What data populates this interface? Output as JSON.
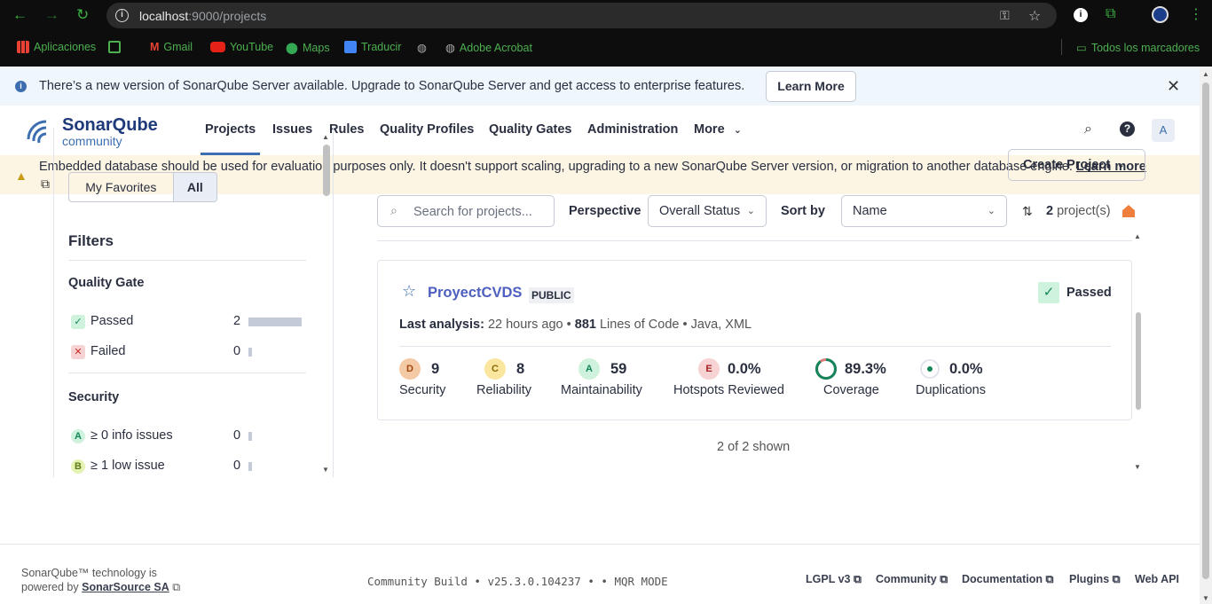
{
  "browser": {
    "url_host": "localhost",
    "url_rest": ":9000/projects",
    "bookmarks": [
      "Aplicaciones",
      "Gmail",
      "YouTube",
      "Maps",
      "Traducir",
      "Adobe Acrobat",
      "Todos los marcadores"
    ]
  },
  "upgrade_banner": {
    "text": "There’s a new version of SonarQube Server available. Upgrade to SonarQube Server and get access to enterprise features.",
    "button": "Learn More"
  },
  "header": {
    "logo_name": "SonarQube",
    "logo_sub": "community",
    "nav": [
      "Projects",
      "Issues",
      "Rules",
      "Quality Profiles",
      "Quality Gates",
      "Administration",
      "More"
    ],
    "avatar": "A"
  },
  "db_banner": {
    "text": "Embedded database should be used for evaluation purposes only. It doesn't support scaling, upgrading to a new SonarQube Server version, or migration to another database engine.",
    "link": "Learn more"
  },
  "sidebar": {
    "toggle": [
      "My Favorites",
      "All"
    ],
    "filters_title": "Filters",
    "quality_gate": {
      "title": "Quality Gate",
      "rows": [
        {
          "icon": "✓",
          "label": "Passed",
          "count": "2",
          "fraction": 1.0
        },
        {
          "icon": "✕",
          "label": "Failed",
          "count": "0",
          "fraction": 0
        }
      ]
    },
    "security": {
      "title": "Security",
      "rows": [
        {
          "icon": "A",
          "label": "≥ 0 info issues",
          "count": "0",
          "fraction": 0
        },
        {
          "icon": "B",
          "label": "≥ 1 low issue",
          "count": "0",
          "fraction": 0
        }
      ]
    }
  },
  "main": {
    "create_button": "Create Project",
    "search_placeholder": "Search for projects...",
    "perspective_label": "Perspective",
    "perspective_value": "Overall Status",
    "sort_label": "Sort by",
    "sort_value": "Name",
    "project_count": "2",
    "project_count_suffix": "project(s)",
    "shown": "2 of 2 shown"
  },
  "project": {
    "name": "ProyectCVDS",
    "visibility": "PUBLIC",
    "status": "Passed",
    "last_analysis_label": "Last analysis:",
    "last_analysis_value": "22 hours ago",
    "loc_value": "881",
    "loc_label": "Lines of Code",
    "languages": "Java, XML",
    "metrics": [
      {
        "badge": "D",
        "value": "9",
        "name": "Security",
        "color": "#f4c9a5"
      },
      {
        "badge": "C",
        "value": "8",
        "name": "Reliability",
        "color": "#fbe6a0"
      },
      {
        "badge": "A",
        "value": "59",
        "name": "Maintainability",
        "color": "#cff2dd"
      },
      {
        "badge": "E",
        "value": "0.0%",
        "name": "Hotspots Reviewed",
        "color": "#f8d3d3"
      },
      {
        "badge": "",
        "value": "89.3%",
        "name": "Coverage",
        "color": "#13855a"
      },
      {
        "badge": "",
        "value": "0.0%",
        "name": "Duplications",
        "color": "#13855a"
      }
    ]
  },
  "footer": {
    "line1": "SonarQube™ technology is",
    "line2_prefix": "powered by",
    "line2_link": "SonarSource SA",
    "build": "Community Build • v25.3.0.104237 • • MQR MODE",
    "links": [
      "LGPL v3",
      "Community",
      "Documentation",
      "Plugins",
      "Web API"
    ]
  }
}
